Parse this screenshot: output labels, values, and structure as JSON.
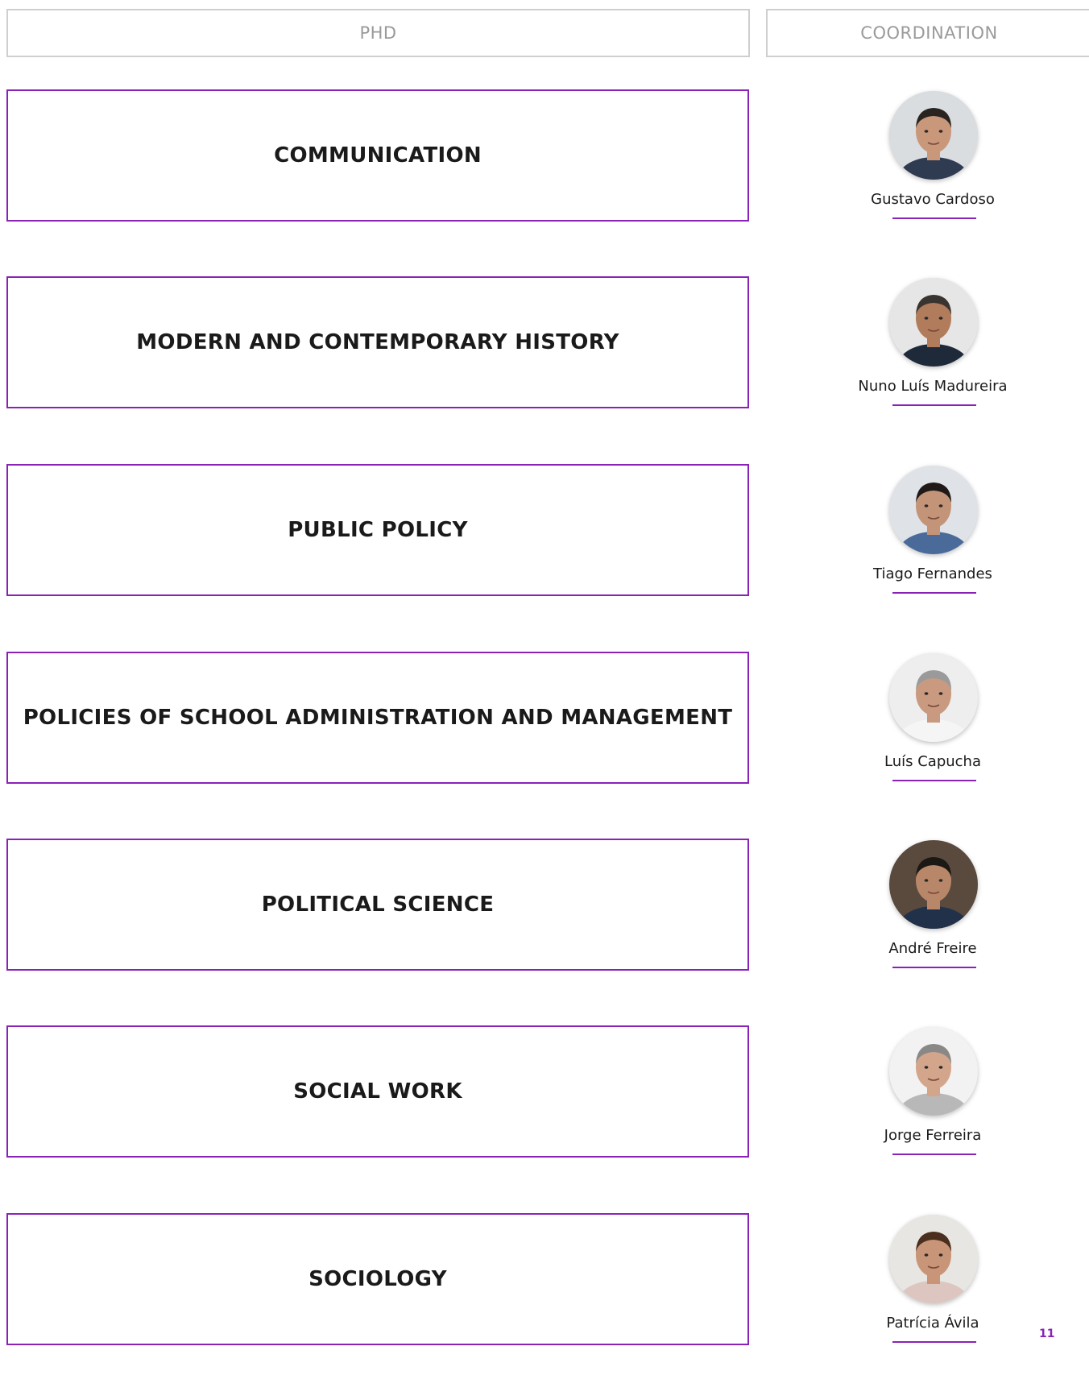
{
  "headers": {
    "phd": "PHD",
    "coordination": "COORDINATION"
  },
  "programs": [
    {
      "title": "COMMUNICATION",
      "coordinator": "Gustavo Cardoso",
      "avatar": {
        "bg": "#d9dde0",
        "skin": "#c9987a",
        "hair": "#2a2420",
        "shirt": "#2e3b50"
      }
    },
    {
      "title": "MODERN AND CONTEMPORARY HISTORY",
      "coordinator": "Nuno Luís Madureira",
      "avatar": {
        "bg": "#e6e6e6",
        "skin": "#b07c5c",
        "hair": "#3a3430",
        "shirt": "#1e2a3a"
      }
    },
    {
      "title": "PUBLIC POLICY",
      "coordinator": "Tiago Fernandes",
      "avatar": {
        "bg": "#dfe3e8",
        "skin": "#c49478",
        "hair": "#1f1a18",
        "shirt": "#4a6a9a"
      }
    },
    {
      "title": "POLICIES OF SCHOOL ADMINISTRATION AND MANAGEMENT",
      "coordinator": "Luís Capucha",
      "avatar": {
        "bg": "#eeeeee",
        "skin": "#c99a80",
        "hair": "#9a9a9a",
        "shirt": "#f5f5f5"
      }
    },
    {
      "title": "POLITICAL SCIENCE",
      "coordinator": "André Freire",
      "avatar": {
        "bg": "#5a4a3e",
        "skin": "#b8876a",
        "hair": "#1c1814",
        "shirt": "#22314a"
      }
    },
    {
      "title": "SOCIAL WORK",
      "coordinator": "Jorge Ferreira",
      "avatar": {
        "bg": "#f2f2f2",
        "skin": "#d3a68c",
        "hair": "#8a8886",
        "shirt": "#b8b8b8"
      }
    },
    {
      "title": "SOCIOLOGY",
      "coordinator": "Patrícia Ávila",
      "avatar": {
        "bg": "#e8e6e2",
        "skin": "#c99578",
        "hair": "#4a2e1e",
        "shirt": "#ddc6c0"
      }
    }
  ],
  "page_number": "11",
  "colors": {
    "accent": "#8a22b8",
    "header_border": "#cfcfcf",
    "header_text": "#9a9a9a"
  }
}
